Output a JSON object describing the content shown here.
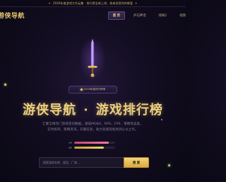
{
  "announcement": {
    "text": "2026年度游戏大作云集 · 排行榜全新上线，快来发现你的挚爱"
  },
  "header": {
    "logo": "游侠导航",
    "nav": [
      {
        "label": "首 页",
        "active": true
      },
      {
        "label": "护石神话",
        "active": false
      },
      {
        "label": "排网2",
        "active": false
      },
      {
        "label": "视频",
        "active": false
      }
    ]
  },
  "hero": {
    "badge": "2026年度排行榜单",
    "title_part1": "游侠导航",
    "title_sep": "·",
    "title_part2": "游戏排行榜",
    "subtitle": "汇聚全网热门游戏资讯数据，涵盖MOBA、RPG、FPS、策略等品类，实时排序，策略资讯，开服信息，助力玩家轻松找到心仪之作。",
    "stats": [
      {
        "label": "HP",
        "value": 0.85
      },
      {
        "label": "MP",
        "value": 0.72
      }
    ]
  },
  "search": {
    "placeholder": "搜索游戏名称、类型、厂商...",
    "button_label": "搜 索"
  },
  "colors": {
    "accent_gold": "#eccf7e",
    "accent_purple": "#7b4fc2",
    "background": "#120d20"
  }
}
